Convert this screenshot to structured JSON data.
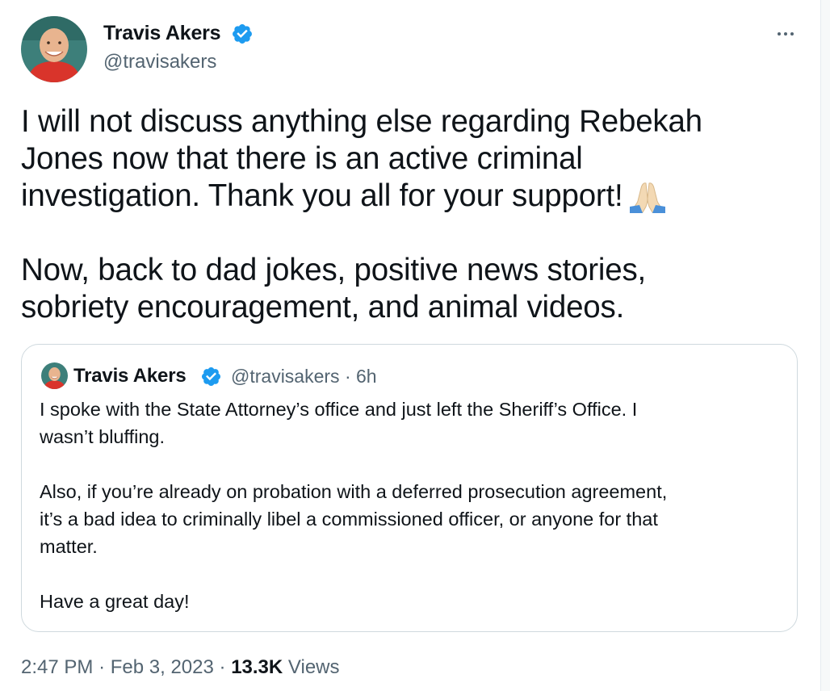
{
  "tweet": {
    "author_name": "Travis Akers",
    "author_handle": "@travisakers",
    "verified": true,
    "text_lines_p1": [
      "I will not discuss anything else regarding Rebekah",
      "Jones now that there is an active criminal",
      "investigation. Thank you all for your support!"
    ],
    "text_lines_p2": [
      "Now, back to dad jokes, positive news stories,",
      "sobriety encouragement, and animal videos."
    ],
    "emoji": "folded-hands-emoji"
  },
  "quoted_tweet": {
    "author_name": "Travis Akers",
    "author_handle": "@travisakers",
    "separator": "·",
    "time_ago": "6h",
    "verified": true,
    "paragraphs": [
      [
        "I spoke with the State Attorney’s office and just left the Sheriff’s Office. I",
        "wasn’t bluffing."
      ],
      [
        "Also, if you’re already on probation with a deferred prosecution agreement,",
        "it’s a bad idea to criminally libel a commissioned officer, or anyone for that",
        "matter."
      ],
      [
        "Have a great day!"
      ]
    ]
  },
  "footer": {
    "time": "2:47 PM",
    "separator": "·",
    "date": "Feb 3, 2023",
    "views_count": "13.3K",
    "views_label": "Views"
  },
  "colors": {
    "text_primary": "#0f1419",
    "text_secondary": "#536471",
    "verified_blue": "#1d9bf0",
    "border": "#cfd9de"
  }
}
